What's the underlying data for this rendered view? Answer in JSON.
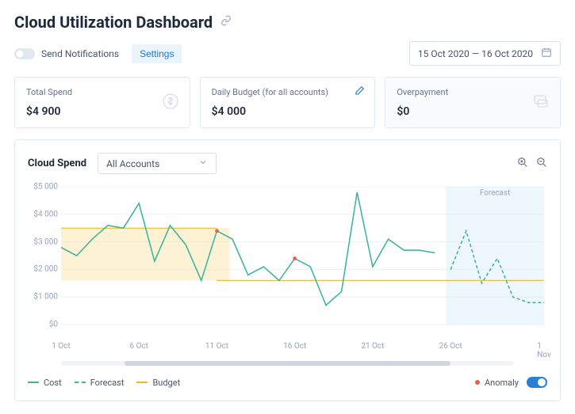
{
  "header": {
    "title": "Cloud Utilization Dashboard",
    "notifications_label": "Send Notifications",
    "settings_label": "Settings",
    "date_range": "15 Oct 2020 — 16 Oct 2020"
  },
  "cards": {
    "total_spend_label": "Total Spend",
    "total_spend_value": "$4 900",
    "daily_budget_label": "Daily Budget (for all accounts)",
    "daily_budget_value": "$4 000",
    "overpayment_label": "Overpayment",
    "overpayment_value": "$0"
  },
  "chart": {
    "title": "Cloud Spend",
    "accounts_label": "All Accounts",
    "forecast_label": "Forecast",
    "legend": {
      "cost": "Cost",
      "forecast": "Forecast",
      "budget": "Budget",
      "anomaly": "Anomaly"
    }
  },
  "chart_data": {
    "type": "line",
    "xlabel": "",
    "ylabel": "",
    "ylim": [
      0,
      5000
    ],
    "y_ticks": [
      "$0",
      "$1 000",
      "$2 000",
      "$3 000",
      "$4 000",
      "$5 000"
    ],
    "x_ticks": [
      "1 Oct",
      "6 Oct",
      "11 Oct",
      "16 Oct",
      "21 Oct",
      "26 Oct",
      "1 Nov"
    ],
    "series": [
      {
        "name": "Cost",
        "x": [
          1,
          2,
          3,
          4,
          5,
          6,
          7,
          8,
          9,
          10,
          11,
          12,
          13,
          14,
          15,
          16,
          17,
          18,
          19,
          20,
          21,
          22,
          23,
          24,
          25
        ],
        "y": [
          2800,
          2500,
          3100,
          3600,
          3500,
          4400,
          2300,
          3600,
          2900,
          1600,
          3400,
          3100,
          1800,
          2100,
          1600,
          2400,
          2100,
          700,
          1200,
          4800,
          2100,
          3100,
          2700,
          2700,
          2600
        ]
      },
      {
        "name": "Forecast",
        "x": [
          26,
          27,
          28,
          29,
          30,
          31,
          32
        ],
        "y": [
          2000,
          3400,
          1500,
          2400,
          1000,
          800,
          800
        ]
      },
      {
        "name": "Budget",
        "segments": [
          {
            "x_range": [
              1,
              11
            ],
            "y": 3500
          },
          {
            "x_range": [
              11,
              32
            ],
            "y": 1600
          }
        ]
      }
    ],
    "anomalies": [
      {
        "x": 11,
        "y": 3400
      },
      {
        "x": 16,
        "y": 2400
      }
    ],
    "anomaly_band": {
      "x_range": [
        1,
        11.8
      ],
      "y_range": [
        1600,
        3500
      ]
    },
    "forecast_band_x_range": [
      25.7,
      32
    ]
  }
}
